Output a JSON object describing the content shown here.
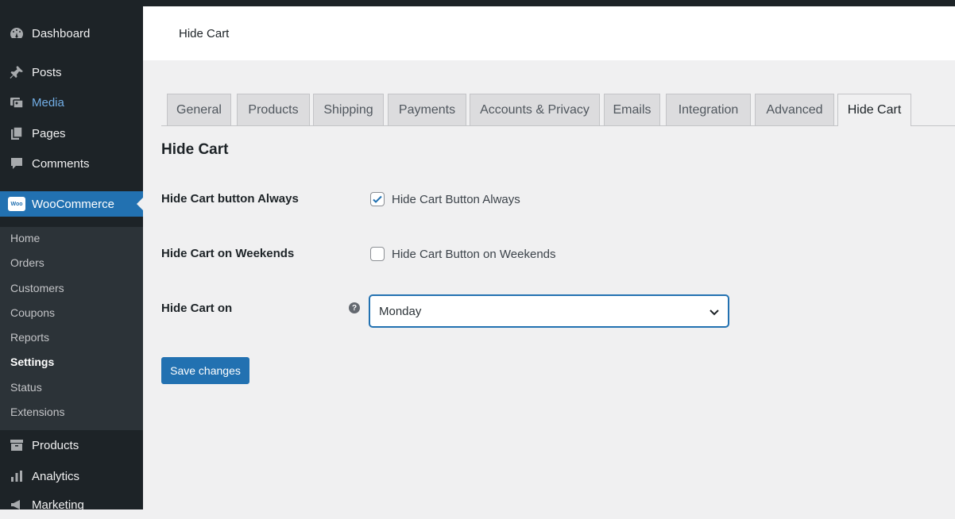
{
  "sidebar": {
    "items": [
      {
        "label": "Dashboard",
        "icon": "dashboard-icon"
      },
      {
        "label": "Posts",
        "icon": "pin-icon"
      },
      {
        "label": "Media",
        "icon": "media-icon"
      },
      {
        "label": "Pages",
        "icon": "pages-icon"
      },
      {
        "label": "Comments",
        "icon": "comment-icon"
      },
      {
        "label": "WooCommerce",
        "icon": "woo-icon"
      },
      {
        "label": "Products",
        "icon": "archive-icon"
      },
      {
        "label": "Analytics",
        "icon": "bar-chart-icon"
      },
      {
        "label": "Marketing",
        "icon": "megaphone-icon"
      }
    ],
    "woo_badge": "Woo",
    "submenu": [
      "Home",
      "Orders",
      "Customers",
      "Coupons",
      "Reports",
      "Settings",
      "Status",
      "Extensions"
    ],
    "current_submenu": "Settings"
  },
  "header": {
    "title": "Hide Cart"
  },
  "tabs": [
    "General",
    "Products",
    "Shipping",
    "Payments",
    "Accounts & Privacy",
    "Emails",
    "Integration",
    "Advanced",
    "Hide Cart"
  ],
  "active_tab": "Hide Cart",
  "section": {
    "title": "Hide Cart"
  },
  "fields": {
    "always": {
      "label": "Hide Cart button Always",
      "checkbox_label": "Hide Cart Button Always",
      "checked": true
    },
    "weekends": {
      "label": "Hide Cart on Weekends",
      "checkbox_label": "Hide Cart Button on Weekends",
      "checked": false
    },
    "day": {
      "label": "Hide Cart on",
      "help": "?",
      "selected": "Monday"
    }
  },
  "save_label": "Save changes",
  "colors": {
    "accent": "#2271b1",
    "sidebar": "#1d2327",
    "media_link": "#72aee6"
  }
}
